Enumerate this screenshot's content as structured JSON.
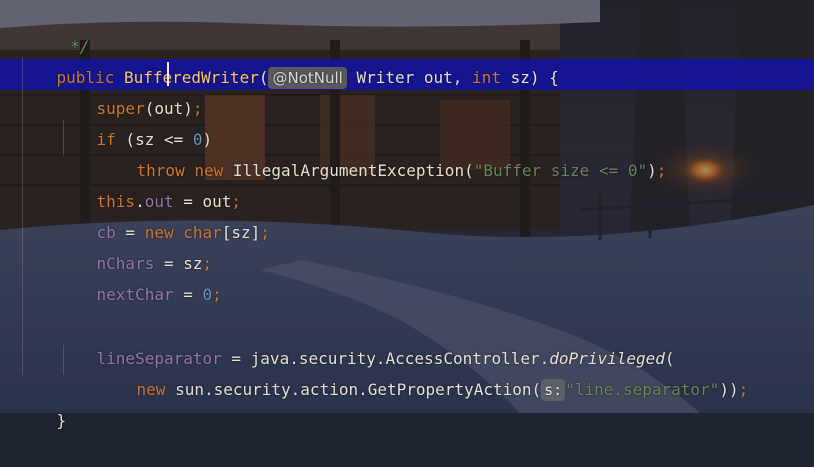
{
  "editor": {
    "line_comment": " */",
    "l1": {
      "kw": "public ",
      "method": "BufferedWriter",
      "open": "(",
      "annotation": "@NotNull",
      "rest": " Writer out, int sz) {"
    },
    "l1b": {
      "type": "Writer out, ",
      "kw_int": "int",
      "tail": " sz) {"
    },
    "l2": {
      "kw": "super",
      "rest": "(out)",
      "semi": ";"
    },
    "l3": {
      "kw": "if",
      "a": " (sz <= ",
      "num": "0",
      "b": ")"
    },
    "l4": {
      "kw1": "throw",
      "sp": " ",
      "kw2": "new",
      "cls": " IllegalArgumentException(",
      "str": "\"Buffer size <= 0\"",
      "close": ")",
      "semi": ";"
    },
    "l5": {
      "kw": "this",
      "dot": ".",
      "fld": "out",
      "rest": " = out",
      "semi": ";"
    },
    "l6": {
      "fld": "cb",
      "eq": " = ",
      "kw": "new",
      "type": " char",
      "rest": "[sz]",
      "semi": ";"
    },
    "l7": {
      "fld": "nChars",
      "rest": " = sz",
      "semi": ";"
    },
    "l8": {
      "fld": "nextChar",
      "eq": " = ",
      "num": "0",
      "semi": ";"
    },
    "l9": {
      "fld": "lineSeparator",
      "rest": " = java.security.AccessController.",
      "method": "doPrivileged",
      "open": "("
    },
    "l10": {
      "kw": "new",
      "rest": " sun.security.action.GetPropertyAction(",
      "hint": "s:",
      "str": "\"line.separator\"",
      "close": "))",
      "semi": ";"
    },
    "l11": {
      "brace": "}"
    }
  }
}
